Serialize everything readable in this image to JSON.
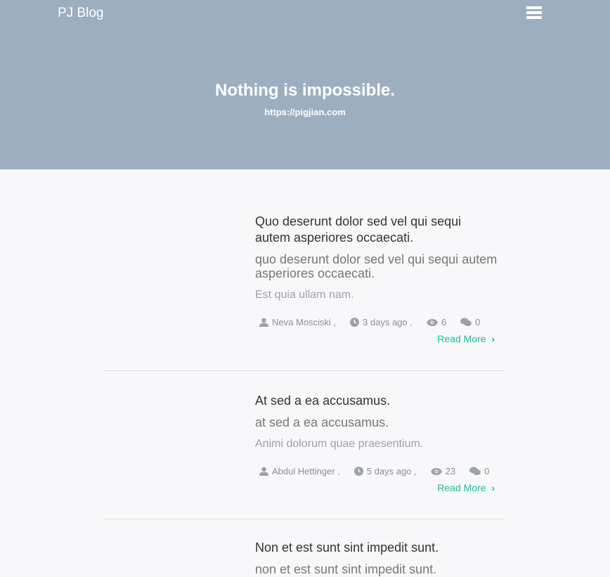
{
  "header": {
    "brand": "PJ Blog",
    "menu_icon": "hamburger-icon",
    "title": "Nothing is impossible.",
    "subtitle": "https://pigjian.com"
  },
  "colors": {
    "header_bg": "#9daec1",
    "accent": "#1abc9c"
  },
  "posts": [
    {
      "title": "Quo deserunt dolor sed vel qui sequi autem asperiores occaecati.",
      "subtitle": "quo deserunt dolor sed vel qui sequi autem asperiores occaecati.",
      "excerpt": "Est quia ullam nam.",
      "author": "Neva Mosciski ,",
      "time": "3 days ago ,",
      "views": "6",
      "comments": "0",
      "read_more": "Read More"
    },
    {
      "title": "At sed a ea accusamus.",
      "subtitle": "at sed a ea accusamus.",
      "excerpt": "Animi dolorum quae praesentium.",
      "author": "Abdul Hettinger ,",
      "time": "5 days ago ,",
      "views": "23",
      "comments": "0",
      "read_more": "Read More"
    },
    {
      "title": "Non et est sunt sint impedit sunt.",
      "subtitle": "non et est sunt sint impedit sunt."
    }
  ]
}
